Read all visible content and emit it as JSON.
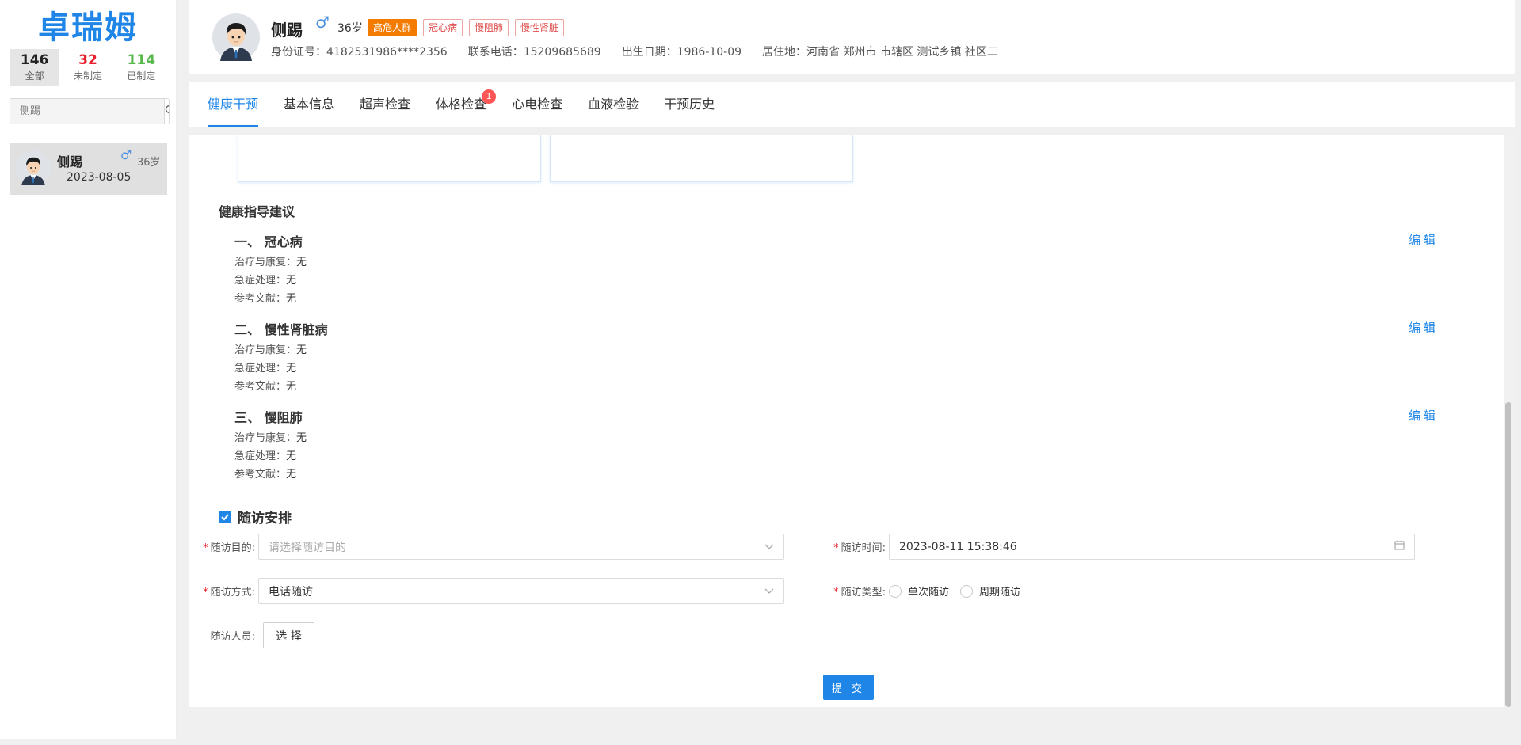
{
  "app": {
    "logo": "卓瑞姆"
  },
  "sidebar": {
    "counts": [
      {
        "num": "146",
        "label": "全部",
        "color": "#222222"
      },
      {
        "num": "32",
        "label": "未制定",
        "color": "#e8202e"
      },
      {
        "num": "114",
        "label": "已制定",
        "color": "#56b84b"
      }
    ],
    "search": {
      "placeholder": "侧踢"
    },
    "patients": [
      {
        "name": "侧踢",
        "sex": "♂",
        "age": "36岁",
        "date": "2023-08-05"
      }
    ]
  },
  "patient": {
    "name": "侧踢",
    "sex": "♂",
    "age": "36岁",
    "tags": [
      "高危人群",
      "冠心病",
      "慢阻肺",
      "慢性肾脏"
    ],
    "id_card": "身份证号：4182531986****2356",
    "phone": "联系电话：15209685689",
    "birth": "出生日期：1986-10-09",
    "address": "居住地：河南省 郑州市 市辖区 测试乡镇 社区二"
  },
  "tabs": [
    {
      "label": "健康干预",
      "active": true
    },
    {
      "label": "基本信息"
    },
    {
      "label": "超声检查"
    },
    {
      "label": "体格检查",
      "badge": "1"
    },
    {
      "label": "心电检查"
    },
    {
      "label": "血液检验"
    },
    {
      "label": "干预历史"
    }
  ],
  "guide": {
    "title": "健康指导建议",
    "edit_label": "编辑",
    "items": [
      {
        "title": "一、 冠心病",
        "treat_label": "治疗与康复：",
        "treat": "无",
        "emergency_label": "急症处理：",
        "emergency": "无",
        "ref_label": "参考文献：",
        "ref": "无"
      },
      {
        "title": "二、 慢性肾脏病",
        "treat_label": "治疗与康复：",
        "treat": "无",
        "emergency_label": "急症处理：",
        "emergency": "无",
        "ref_label": "参考文献：",
        "ref": "无"
      },
      {
        "title": "三、 慢阻肺",
        "treat_label": "治疗与康复：",
        "treat": "无",
        "emergency_label": "急症处理：",
        "emergency": "无",
        "ref_label": "参考文献：",
        "ref": "无"
      }
    ]
  },
  "followup": {
    "title": "随访安排",
    "purpose_label": "随访目的:",
    "purpose_placeholder": "请选择随访目的",
    "time_label": "随访时间:",
    "time_value": "2023-08-11 15:38:46",
    "method_label": "随访方式:",
    "method_value": "电话随访",
    "type_label": "随访类型:",
    "type_options": [
      "单次随访",
      "周期随访"
    ],
    "staff_label": "随访人员:",
    "select_label": "选 择",
    "submit_label": "提 交"
  },
  "colors": {
    "accent": "#1f86e8",
    "danger": "#e8202e",
    "success": "#56b84b",
    "hot_tag": "#f37b00"
  }
}
